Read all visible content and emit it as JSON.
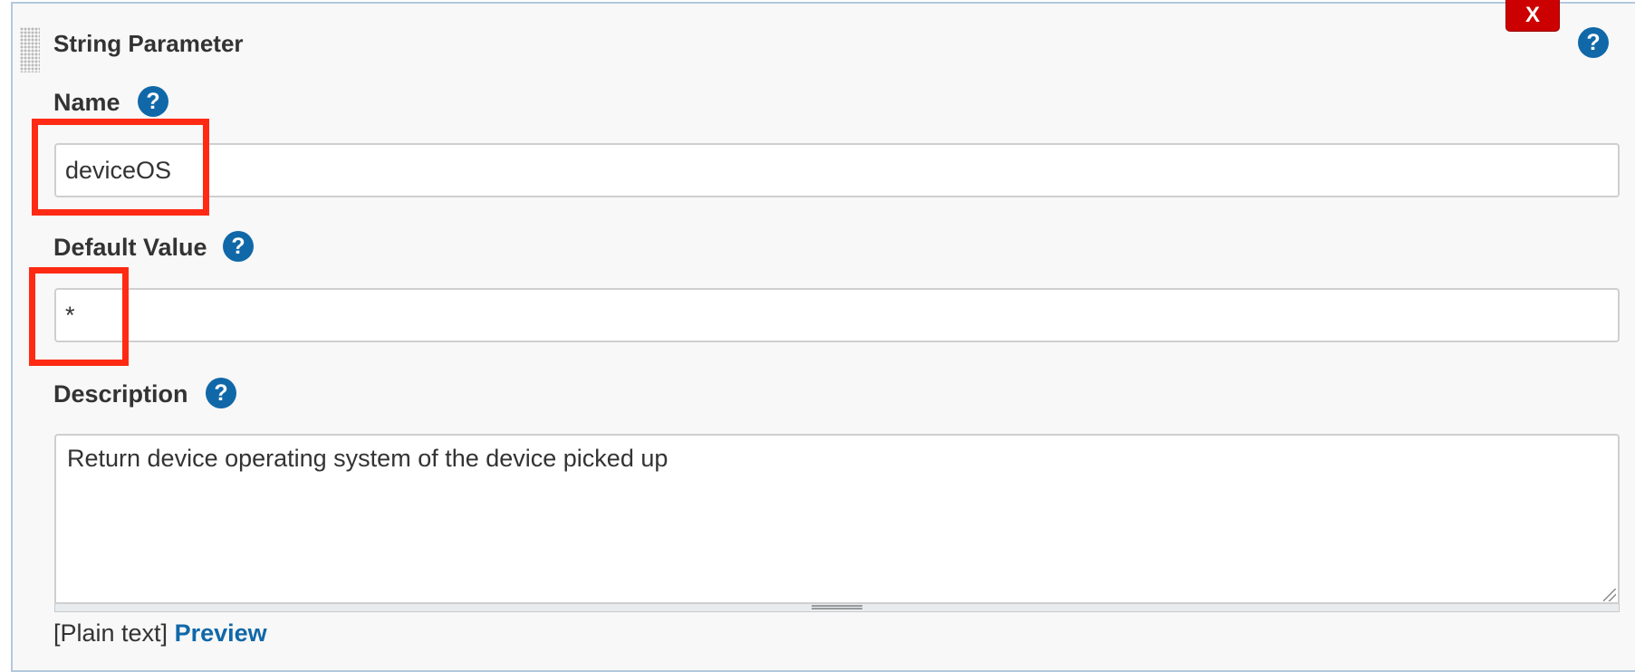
{
  "section": {
    "title": "String Parameter",
    "delete_label": "X",
    "help_glyph": "?"
  },
  "fields": {
    "name": {
      "label": "Name",
      "value": "deviceOS"
    },
    "default_value": {
      "label": "Default Value",
      "value": "*"
    },
    "description": {
      "label": "Description",
      "value": "Return device operating system of the device picked up"
    }
  },
  "syntax": {
    "mode_label": "[Plain text]",
    "preview_label": "Preview"
  },
  "colors": {
    "help_icon": "#1068a8",
    "delete_button": "#cc0000",
    "highlight_annotation": "#ff2a14",
    "panel_background": "#f8f8f8"
  },
  "icons": {
    "help": "question-mark-circle-icon",
    "drag": "drag-handle-icon",
    "resize": "resize-grip-icon"
  }
}
